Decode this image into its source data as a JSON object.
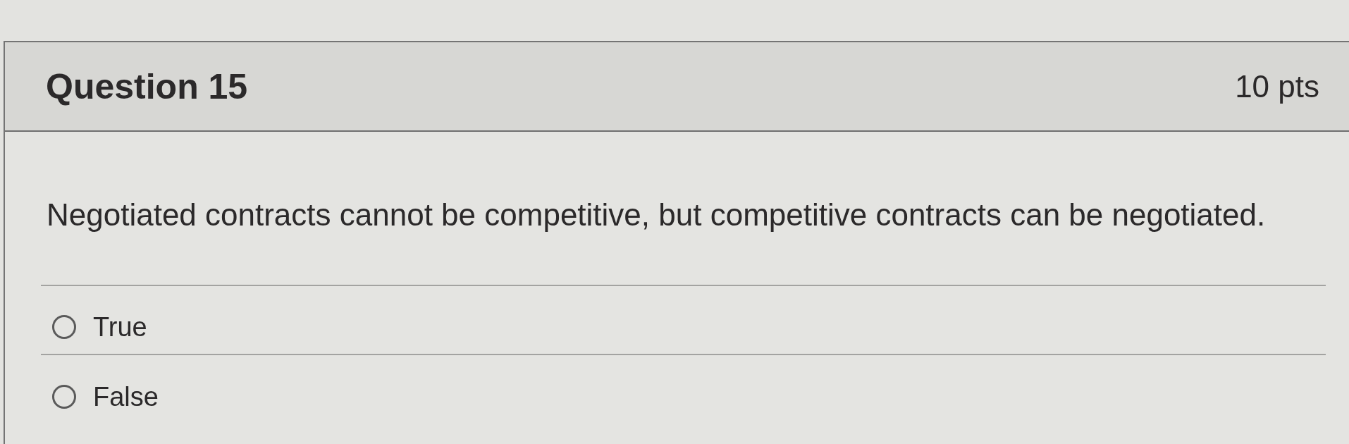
{
  "question": {
    "title": "Question 15",
    "points": "10 pts"
  },
  "prompt": "Negotiated contracts cannot be competitive, but competitive contracts can be negotiated.",
  "answers": [
    {
      "label": "True",
      "selected": false
    },
    {
      "label": "False",
      "selected": false
    }
  ]
}
